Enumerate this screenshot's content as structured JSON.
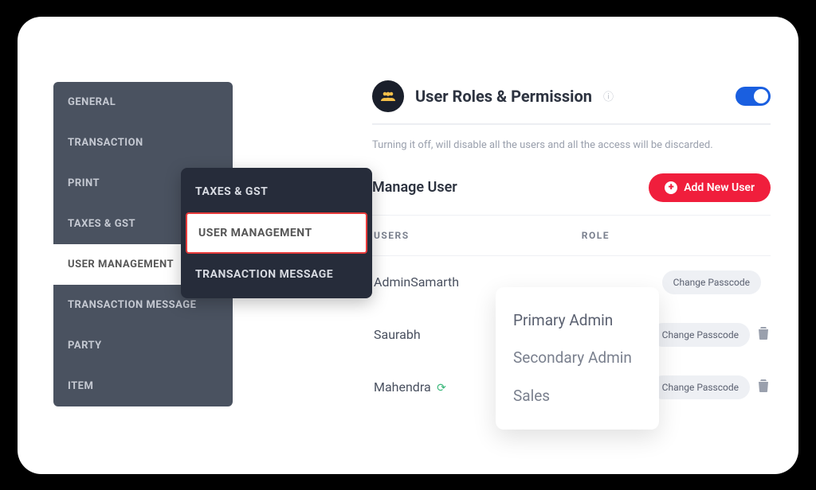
{
  "sidebar": {
    "items": [
      {
        "label": "GENERAL"
      },
      {
        "label": "TRANSACTION"
      },
      {
        "label": "PRINT"
      },
      {
        "label": "TAXES & GST"
      },
      {
        "label": "USER MANAGEMENT"
      },
      {
        "label": "TRANSACTION MESSAGE"
      },
      {
        "label": "PARTY"
      },
      {
        "label": "ITEM"
      }
    ],
    "active_index": 4
  },
  "sidebar_float": {
    "items": [
      {
        "label": "TAXES & GST"
      },
      {
        "label": "USER MANAGEMENT"
      },
      {
        "label": "TRANSACTION MESSAGE"
      }
    ],
    "highlight_index": 1
  },
  "header": {
    "title": "User Roles & Permission",
    "toggle_on": true,
    "hint": "Turning it off, will disable all the users and all the access will be discarded."
  },
  "manage": {
    "title": "Manage User",
    "add_button": "Add New User"
  },
  "table": {
    "headers": {
      "users": "USERS",
      "role": "ROLE"
    },
    "rows": [
      {
        "user": "AdminSamarth",
        "action": "Change Passcode",
        "can_delete": false,
        "syncing": false
      },
      {
        "user": "Saurabh",
        "action": "Change Passcode",
        "can_delete": true,
        "syncing": false
      },
      {
        "user": "Mahendra",
        "action": "Change Passcode",
        "can_delete": true,
        "syncing": true
      }
    ]
  },
  "role_popover": {
    "options": [
      {
        "label": "Primary Admin"
      },
      {
        "label": "Secondary Admin"
      },
      {
        "label": "Sales"
      }
    ]
  }
}
